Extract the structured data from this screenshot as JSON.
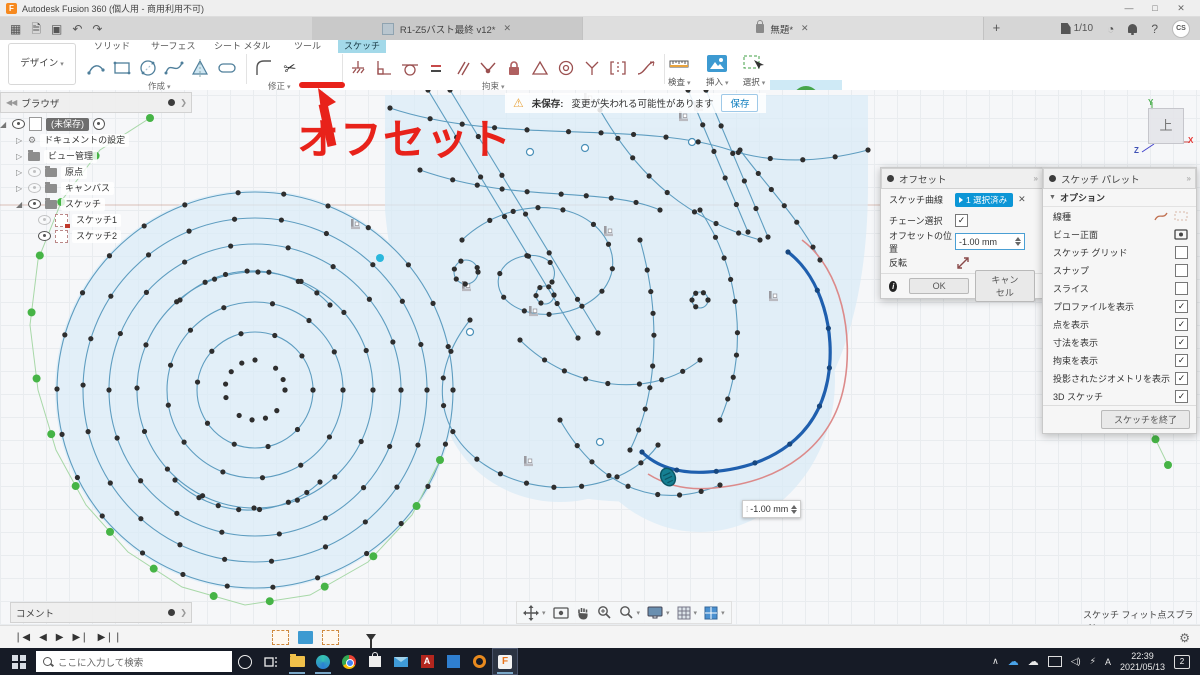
{
  "window": {
    "app_title": "Autodesk Fusion 360 (個人用 - 商用利用不可)"
  },
  "tab_bar": {
    "doc_tabs": [
      {
        "label": "R1-Z5バスト最終 v12*"
      },
      {
        "label": "無題*"
      }
    ],
    "page_badge": "1/10",
    "avatar_initials": "CS"
  },
  "workspace": {
    "label": "デザイン"
  },
  "ribbon": {
    "tabs": [
      {
        "label": "ソリッド"
      },
      {
        "label": "サーフェス"
      },
      {
        "label": "シート メタル"
      },
      {
        "label": "ツール"
      },
      {
        "label": "スケッチ",
        "active": true
      }
    ],
    "groups": {
      "create": "作成",
      "modify": "修正",
      "constraints": "拘束",
      "inspect": "検査",
      "insert": "挿入",
      "select": "選択"
    },
    "finish_sketch": "スケッチを終了"
  },
  "annotation": {
    "label": "オフセット",
    "color": "#e8221a"
  },
  "save_bar": {
    "title": "未保存:",
    "message": "変更が失われる可能性があります",
    "save_button": "保存"
  },
  "browser": {
    "title": "ブラウザ",
    "root_label": "(未保存)",
    "items": [
      {
        "label": "ドキュメントの設定"
      },
      {
        "label": "ビュー管理"
      },
      {
        "label": "原点"
      },
      {
        "label": "キャンバス"
      },
      {
        "label": "スケッチ"
      },
      {
        "label": "スケッチ1"
      },
      {
        "label": "スケッチ2"
      }
    ]
  },
  "offset_dialog": {
    "title": "オフセット",
    "curve_label": "スケッチ曲線",
    "curve_value": "1 選択済み",
    "chain_label": "チェーン選択",
    "chain_checked": true,
    "position_label": "オフセットの位置",
    "position_value": "-1.00 mm",
    "flip_label": "反転",
    "ok_label": "OK",
    "cancel_label": "キャンセル"
  },
  "sketch_palette": {
    "title": "スケッチ パレット",
    "section": "オプション",
    "rows": [
      {
        "label": "線種"
      },
      {
        "label": "ビュー正面"
      },
      {
        "label": "スケッチ グリッド",
        "checked": false
      },
      {
        "label": "スナップ",
        "checked": false
      },
      {
        "label": "スライス",
        "checked": false
      },
      {
        "label": "プロファイルを表示",
        "checked": true
      },
      {
        "label": "点を表示",
        "checked": true
      },
      {
        "label": "寸法を表示",
        "checked": true
      },
      {
        "label": "拘束を表示",
        "checked": true
      },
      {
        "label": "投影されたジオメトリを表示",
        "checked": true
      },
      {
        "label": "3D スケッチ",
        "checked": true
      }
    ],
    "finish_button": "スケッチを終了"
  },
  "floating_input": {
    "value": "-1.00 mm"
  },
  "comments": {
    "title": "コメント"
  },
  "status_bar": {
    "tool_hint": "スケッチ フィット点スプライン"
  },
  "viewcube": {
    "face": "上",
    "axis_x": "X",
    "axis_y": "Y",
    "axis_z": "Z"
  },
  "taskbar": {
    "search_placeholder": "ここに入力して検索",
    "ime": "A",
    "time": "22:39",
    "date": "2021/05/13",
    "badge_count": "2"
  },
  "icons": {
    "trim": "✂",
    "check": "✓",
    "undo": "↶",
    "redo": "↷",
    "warning": "⚠",
    "gear": "⚙",
    "grid": "▦"
  },
  "colors": {
    "accent_blue": "#0c96d6",
    "annotation_red": "#e8221a",
    "select_green": "#46b446",
    "fusion_orange": "#f6891f",
    "profile_fill": "#d9ebf7"
  }
}
